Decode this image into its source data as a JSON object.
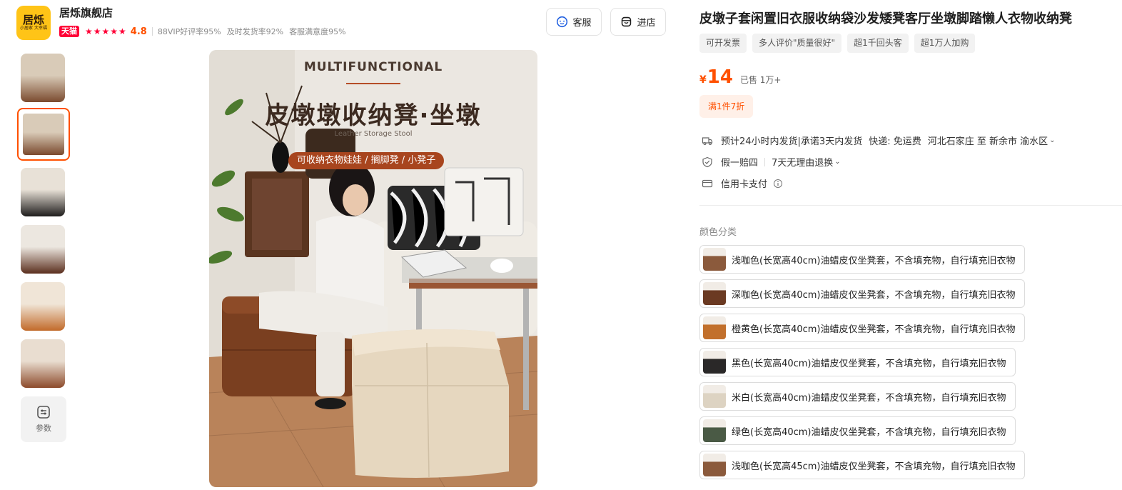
{
  "store": {
    "logo_main": "居烁",
    "logo_sub": "小居家 大幸福",
    "name": "居烁旗舰店",
    "badge": "天猫",
    "stars": "★★★★★",
    "rating": "4.8",
    "stats": [
      "88VIP好评率95%",
      "及时发货率92%",
      "客服满意度95%"
    ],
    "service_label": "客服",
    "shop_label": "进店"
  },
  "gallery": {
    "thumbnails": [
      {
        "name": "thumb-1",
        "colors": [
          "#d9cbb8",
          "#7a4a2e"
        ]
      },
      {
        "name": "thumb-2",
        "colors": [
          "#d9cbb8",
          "#7a4a2e"
        ]
      },
      {
        "name": "thumb-3",
        "colors": [
          "#e8e1d7",
          "#1e1c1c"
        ]
      },
      {
        "name": "thumb-4",
        "colors": [
          "#ece7e0",
          "#5b2f1e"
        ]
      },
      {
        "name": "thumb-5",
        "colors": [
          "#f0e5d7",
          "#c26a2a"
        ]
      },
      {
        "name": "thumb-6",
        "colors": [
          "#e9ddd0",
          "#8c4a2b"
        ]
      }
    ],
    "active_index": 1,
    "params_label": "参数"
  },
  "main_image": {
    "english_title": "MULTIFUNCTIONAL",
    "title": "皮墩墩收纳凳·坐墩",
    "subtitle": "Leather Storage Stool",
    "pill": "可收纳衣物娃娃 / 搁脚凳 / 小凳子"
  },
  "product": {
    "title": "皮墩子套闲置旧衣服收纳袋沙发矮凳客厅坐墩脚踏懒人衣物收纳凳",
    "tags": [
      "可开发票",
      "多人评价\"质量很好\"",
      "超1千回头客",
      "超1万人加购"
    ],
    "price_symbol": "¥",
    "price": "14",
    "sold": "已售 1万+",
    "promo": "满1件7折",
    "shipping": {
      "time": "预计24小时内发货|承诺3天内发货",
      "fee": "快递: 免运费",
      "route": "河北石家庄 至 新余市 渝水区"
    },
    "guarantee": {
      "item1": "假一赔四",
      "item2": "7天无理由退换"
    },
    "payment": "信用卡支付",
    "option_group_label": "颜色分类",
    "options": [
      {
        "label": "浅咖色(长宽高40cm)油蜡皮仅坐凳套，不含填充物，自行填充旧衣物",
        "swatch": "#8b5a3c"
      },
      {
        "label": "深咖色(长宽高40cm)油蜡皮仅坐凳套，不含填充物，自行填充旧衣物",
        "swatch": "#6b3a22"
      },
      {
        "label": "橙黄色(长宽高40cm)油蜡皮仅坐凳套，不含填充物，自行填充旧衣物",
        "swatch": "#c2702c"
      },
      {
        "label": "黑色(长宽高40cm)油蜡皮仅坐凳套，不含填充物，自行填充旧衣物",
        "swatch": "#2a2828"
      },
      {
        "label": "米白(长宽高40cm)油蜡皮仅坐凳套，不含填充物，自行填充旧衣物",
        "swatch": "#ddd3c2"
      },
      {
        "label": "绿色(长宽高40cm)油蜡皮仅坐凳套，不含填充物，自行填充旧衣物",
        "swatch": "#4a5a45"
      },
      {
        "label": "浅咖色(长宽高45cm)油蜡皮仅坐凳套，不含填充物，自行填充旧衣物",
        "swatch": "#8b5a3c"
      }
    ]
  }
}
